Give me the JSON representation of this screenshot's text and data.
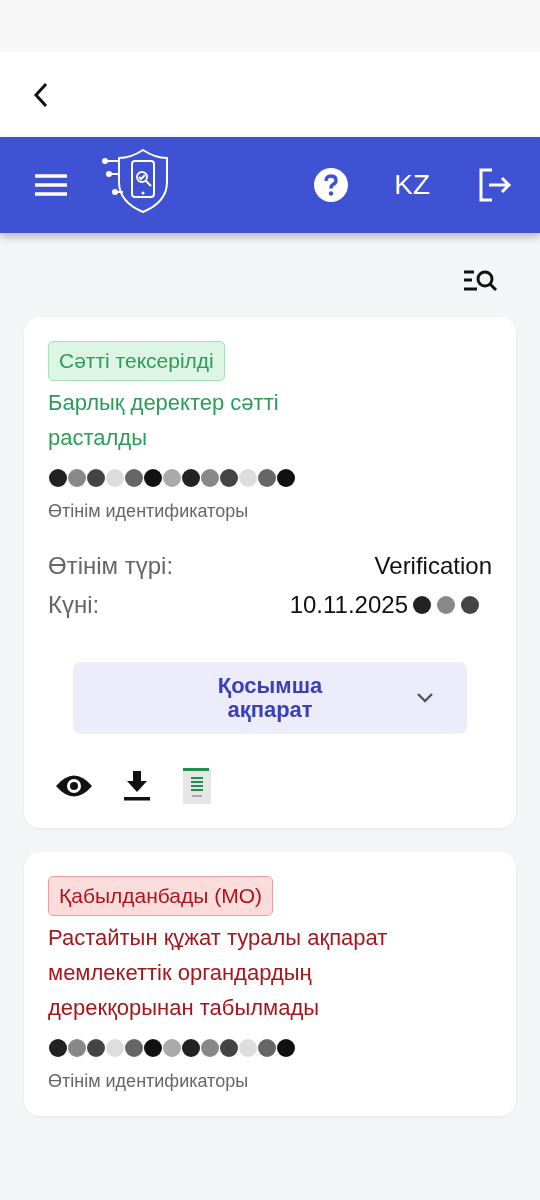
{
  "header": {
    "language": "KZ"
  },
  "cards": [
    {
      "status": {
        "kind": "success",
        "label": "Сәтті тексерілді"
      },
      "message": "Барлық деректер сәтті расталды",
      "id_caption": "Өтінім идентификаторы",
      "details": [
        {
          "label": "Өтінім түрі:",
          "value": "Verification"
        },
        {
          "label": "Күні:",
          "value": "10.11.2025",
          "redacted_tail": true
        }
      ],
      "more": {
        "label": "Қосымша ақпарат",
        "expanded": false
      },
      "actions": [
        {
          "kind": "view"
        },
        {
          "kind": "download"
        },
        {
          "kind": "csv"
        }
      ]
    },
    {
      "status": {
        "kind": "rejected",
        "label": "Қабылданбады (МО)"
      },
      "message": "Растайтын құжат туралы ақпарат мемлекеттік органдардың дерекқорынан табылмады",
      "id_caption": "Өтінім идентификаторы"
    }
  ]
}
